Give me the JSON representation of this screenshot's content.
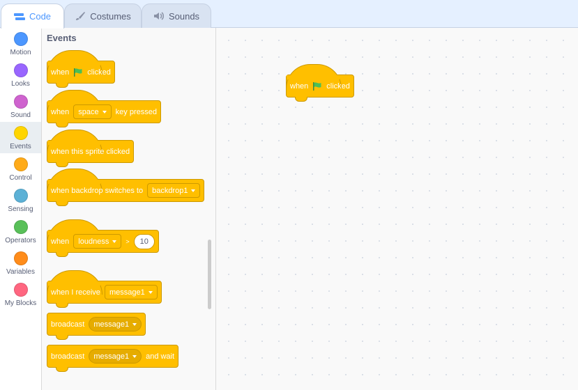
{
  "tabs": [
    {
      "label": "Code",
      "icon": "code-icon",
      "active": true
    },
    {
      "label": "Costumes",
      "icon": "brush-icon",
      "active": false
    },
    {
      "label": "Sounds",
      "icon": "speaker-icon",
      "active": false
    }
  ],
  "categories": [
    {
      "label": "Motion",
      "color": "#4c97ff"
    },
    {
      "label": "Looks",
      "color": "#9966ff"
    },
    {
      "label": "Sound",
      "color": "#cf63cf"
    },
    {
      "label": "Events",
      "color": "#ffd500",
      "selected": true
    },
    {
      "label": "Control",
      "color": "#ffab19"
    },
    {
      "label": "Sensing",
      "color": "#5cb1d6"
    },
    {
      "label": "Operators",
      "color": "#59c059"
    },
    {
      "label": "Variables",
      "color": "#ff8c1a"
    },
    {
      "label": "My Blocks",
      "color": "#ff6680"
    }
  ],
  "palette": {
    "title": "Events",
    "blocks": {
      "flag_clicked": {
        "when": "when",
        "clicked": "clicked"
      },
      "key_pressed": {
        "when": "when",
        "key": "space",
        "suffix": "key pressed"
      },
      "sprite_clicked": {
        "label": "when this sprite clicked"
      },
      "backdrop_switch": {
        "label": "when backdrop switches to",
        "backdrop": "backdrop1"
      },
      "greater_than": {
        "when": "when",
        "sensor": "loudness",
        "op": ">",
        "value": "10"
      },
      "receive": {
        "label": "when I receive",
        "message": "message1"
      },
      "broadcast": {
        "label": "broadcast",
        "message": "message1"
      },
      "broadcast_wait": {
        "label": "broadcast",
        "message": "message1",
        "suffix": "and wait"
      }
    }
  },
  "workspace": {
    "block": {
      "when": "when",
      "clicked": "clicked"
    }
  },
  "colors": {
    "events": "#ffbf00",
    "events_border": "#cc9900",
    "accent": "#4c97ff",
    "flag": "#4cbf56"
  }
}
